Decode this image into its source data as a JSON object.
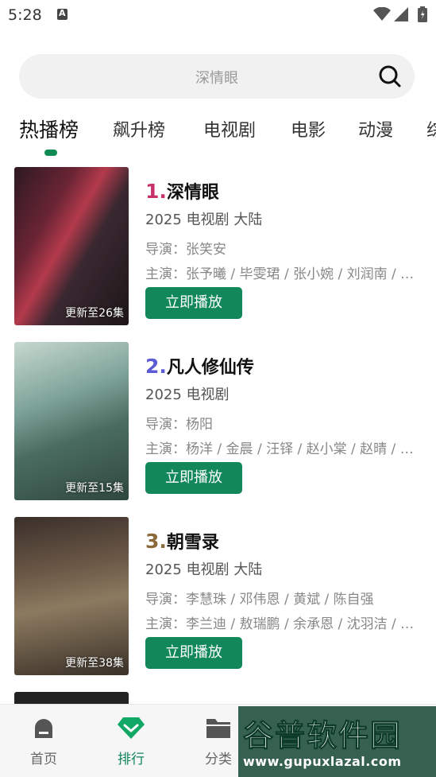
{
  "status_bar": {
    "time": "5:28"
  },
  "search": {
    "placeholder": "深情眼"
  },
  "tabs": [
    {
      "label": "热播榜",
      "active": true
    },
    {
      "label": "飙升榜"
    },
    {
      "label": "电视剧"
    },
    {
      "label": "电影"
    },
    {
      "label": "动漫"
    },
    {
      "label": "综"
    }
  ],
  "items": [
    {
      "rank": "1.",
      "rank_color": "#c8306a",
      "title": "深情眼",
      "meta": "2025  电视剧  大陆",
      "director": "导演：张笑安",
      "cast": "主演：张予曦 / 毕雯珺 / 张小婉 / 刘润南 / 李梦",
      "episodes": "更新至26集",
      "play_label": "立即播放"
    },
    {
      "rank": "2.",
      "rank_color": "#5b5bd6",
      "title": "凡人修仙传",
      "meta": "2025  电视剧",
      "director": "导演：杨阳",
      "cast": "主演：杨洋 / 金晨 / 汪铎 / 赵小棠 / 赵晴 / 王一菲",
      "episodes": "更新至15集",
      "play_label": "立即播放"
    },
    {
      "rank": "3.",
      "rank_color": "#8a6a3a",
      "title": "朝雪录",
      "meta": "2025  电视剧  大陆",
      "director": "导演：李慧珠 / 邓伟恩 / 黄斌 / 陈自强",
      "cast": "主演：李兰迪 / 敖瑞鹏 / 余承恩 / 沈羽洁 / 王小",
      "episodes": "更新至38集",
      "play_label": "立即播放"
    }
  ],
  "bottom_nav": [
    {
      "label": "首页",
      "icon": "home-icon"
    },
    {
      "label": "排行",
      "icon": "ranking-icon",
      "active": true
    },
    {
      "label": "分类",
      "icon": "folder-icon"
    }
  ],
  "watermark": {
    "title": "谷普软件园",
    "url": "www.gupuxlazal.com"
  },
  "colors": {
    "accent": "#11875a"
  }
}
